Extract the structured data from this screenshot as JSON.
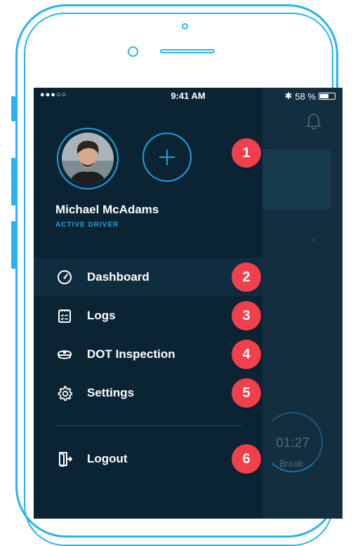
{
  "status_bar": {
    "signal": "●●●○○",
    "time": "9:41 AM",
    "bluetooth": "✱",
    "battery": "58 %",
    "battery_level": 0.58
  },
  "user": {
    "name": "Michael McAdams",
    "status": "ACTIVE DRIVER",
    "avatar_icon": "user-avatar"
  },
  "add_button": {
    "icon": "plus-icon",
    "label": "+"
  },
  "menu": {
    "items": [
      {
        "label": "Dashboard",
        "icon": "dashboard-gauge-icon",
        "active": true
      },
      {
        "label": "Logs",
        "icon": "logs-clipboard-icon"
      },
      {
        "label": "DOT Inspection",
        "icon": "officer-cap-icon"
      },
      {
        "label": "Settings",
        "icon": "gear-icon"
      }
    ],
    "logout": {
      "label": "Logout",
      "icon": "logout-door-icon"
    }
  },
  "background_screen": {
    "timer_value": "01:27",
    "timer_label": "Break",
    "bell_icon": "bell-icon",
    "chevron": "›"
  },
  "callouts": [
    "1",
    "2",
    "3",
    "4",
    "5",
    "6"
  ],
  "colors": {
    "accent": "#21a0dc",
    "drawer_bg": "#0b2434",
    "callout": "#f0404c",
    "phone_outline": "#29b3ef"
  }
}
